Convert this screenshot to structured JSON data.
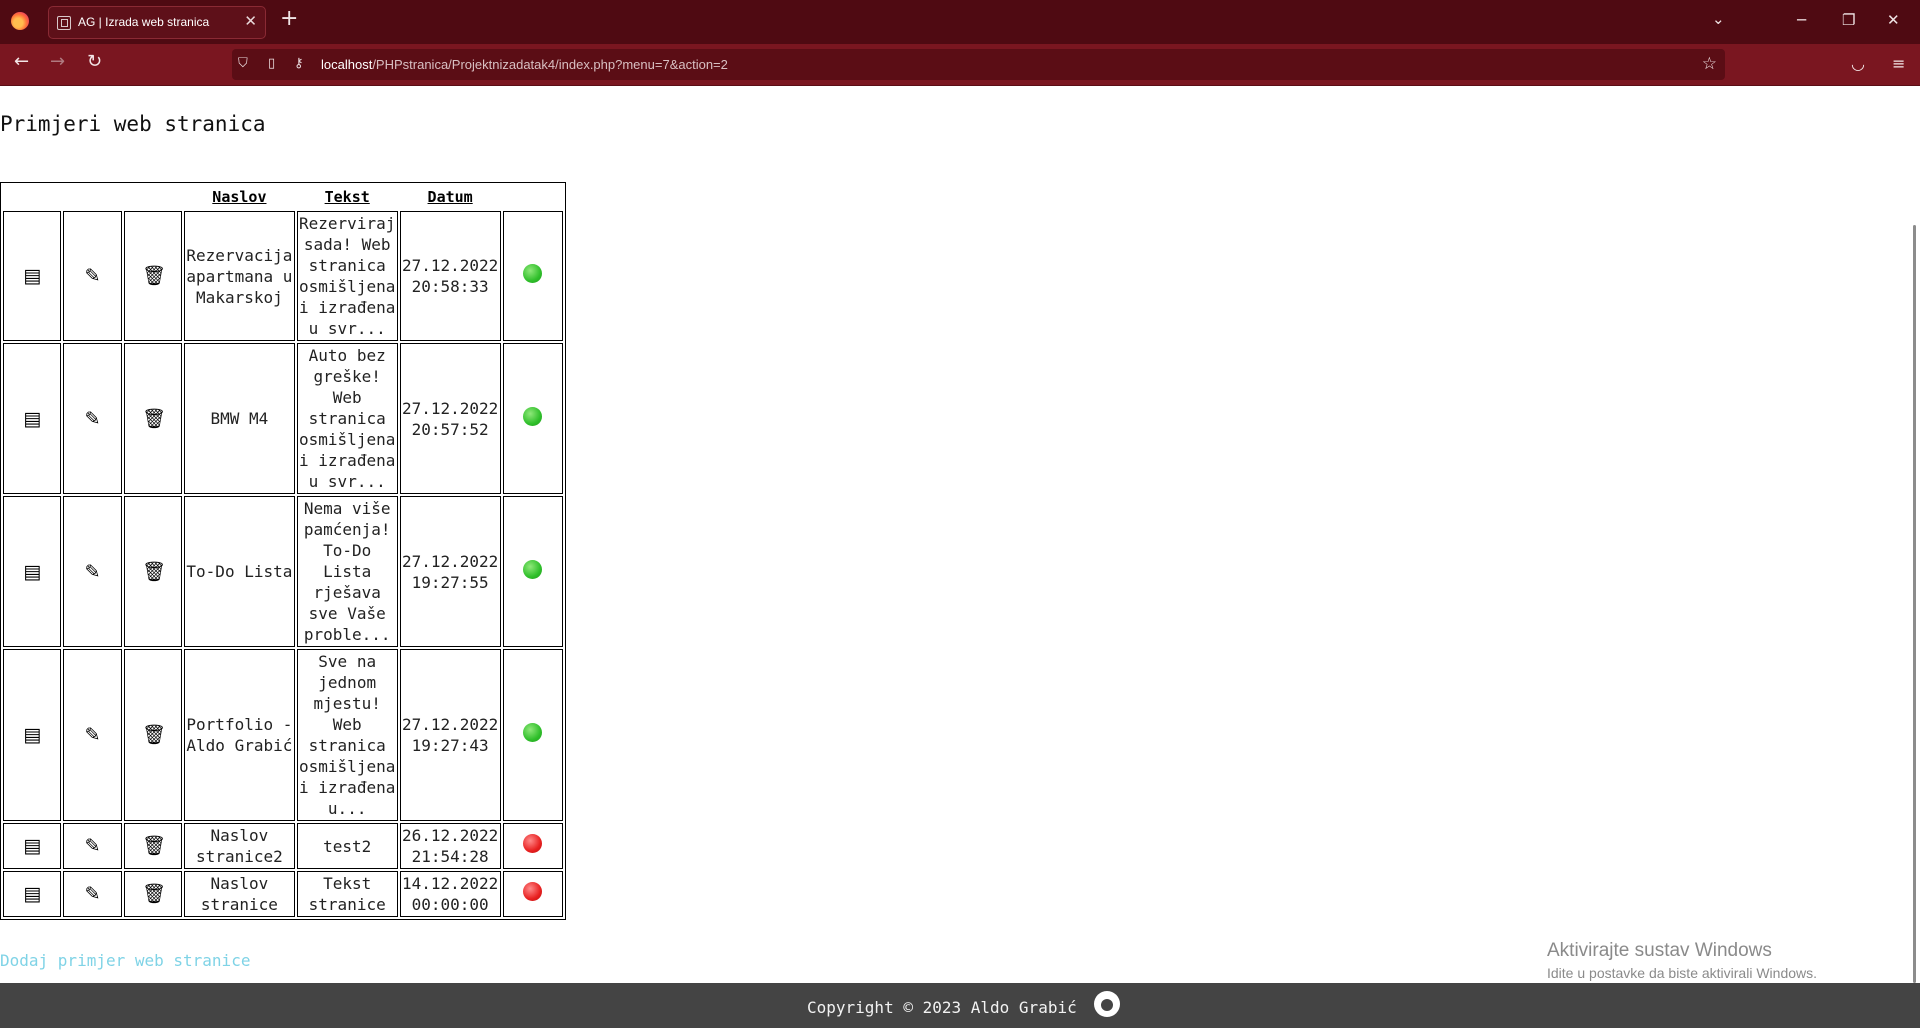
{
  "browser": {
    "tab_title": "AG | Izrada web stranica",
    "tab_close": "✕",
    "new_tab": "+",
    "tab_list": "⌄",
    "minimize": "─",
    "restore": "❐",
    "close": "✕",
    "url_host": "localhost",
    "url_path": "/PHPstranica/Projektnizadatak4/index.php?menu=7&action=2"
  },
  "page": {
    "title": "Primjeri web stranica",
    "table": {
      "headers": {
        "naslov": "Naslov",
        "tekst": "Tekst",
        "datum": "Datum"
      },
      "rows": [
        {
          "naslov": "Rezervacija apartmana u Makarskoj",
          "tekst": "Rezerviraj sada! Web stranica osmišljena i izrađena u svr...",
          "datum": "27.12.2022 20:58:33",
          "active": true
        },
        {
          "naslov": "BMW M4",
          "tekst": "Auto bez greške! Web stranica osmišljena i izrađena u svr...",
          "datum": "27.12.2022 20:57:52",
          "active": true
        },
        {
          "naslov": "To-Do Lista",
          "tekst": "Nema više pamćenja! To-Do Lista rješava sve Vaše proble...",
          "datum": "27.12.2022 19:27:55",
          "active": true
        },
        {
          "naslov": "Portfolio - Aldo Grabić",
          "tekst": "Sve na jednom mjestu! Web stranica osmišljena i izrađena u...",
          "datum": "27.12.2022 19:27:43",
          "active": true
        },
        {
          "naslov": "Naslov stranice2",
          "tekst": "test2",
          "datum": "26.12.2022 21:54:28",
          "active": false
        },
        {
          "naslov": "Naslov stranice",
          "tekst": "Tekst stranice",
          "datum": "14.12.2022 00:00:00",
          "active": false
        }
      ]
    },
    "add_link": "Dodaj primjer web stranice"
  },
  "watermark": {
    "line1": "Aktivirajte sustav Windows",
    "line2": "Idite u postavke da biste aktivirali Windows."
  },
  "footer": {
    "copyright": "Copyright © 2023 Aldo Grabić"
  },
  "icons": {
    "view": "▤",
    "edit": "✎",
    "delete": "🗑"
  },
  "colors": {
    "active": "#2fbf2a",
    "inactive": "#e82020",
    "link": "#7fd3e6",
    "footer_bg": "#444444",
    "chrome_bg": "#4f0a12"
  }
}
